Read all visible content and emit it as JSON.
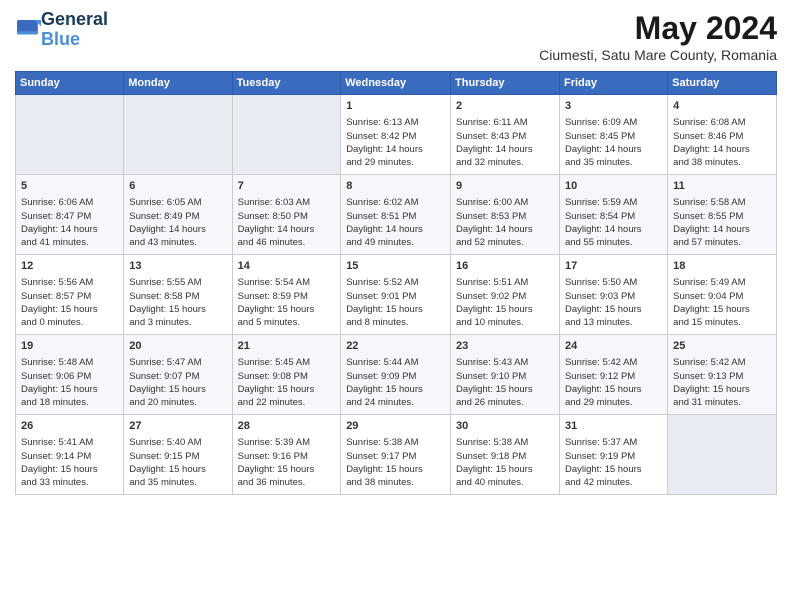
{
  "logo": {
    "line1": "General",
    "line2": "Blue"
  },
  "title": "May 2024",
  "location": "Ciumesti, Satu Mare County, Romania",
  "headers": [
    "Sunday",
    "Monday",
    "Tuesday",
    "Wednesday",
    "Thursday",
    "Friday",
    "Saturday"
  ],
  "weeks": [
    [
      {
        "day": "",
        "content": ""
      },
      {
        "day": "",
        "content": ""
      },
      {
        "day": "",
        "content": ""
      },
      {
        "day": "1",
        "content": "Sunrise: 6:13 AM\nSunset: 8:42 PM\nDaylight: 14 hours\nand 29 minutes."
      },
      {
        "day": "2",
        "content": "Sunrise: 6:11 AM\nSunset: 8:43 PM\nDaylight: 14 hours\nand 32 minutes."
      },
      {
        "day": "3",
        "content": "Sunrise: 6:09 AM\nSunset: 8:45 PM\nDaylight: 14 hours\nand 35 minutes."
      },
      {
        "day": "4",
        "content": "Sunrise: 6:08 AM\nSunset: 8:46 PM\nDaylight: 14 hours\nand 38 minutes."
      }
    ],
    [
      {
        "day": "5",
        "content": "Sunrise: 6:06 AM\nSunset: 8:47 PM\nDaylight: 14 hours\nand 41 minutes."
      },
      {
        "day": "6",
        "content": "Sunrise: 6:05 AM\nSunset: 8:49 PM\nDaylight: 14 hours\nand 43 minutes."
      },
      {
        "day": "7",
        "content": "Sunrise: 6:03 AM\nSunset: 8:50 PM\nDaylight: 14 hours\nand 46 minutes."
      },
      {
        "day": "8",
        "content": "Sunrise: 6:02 AM\nSunset: 8:51 PM\nDaylight: 14 hours\nand 49 minutes."
      },
      {
        "day": "9",
        "content": "Sunrise: 6:00 AM\nSunset: 8:53 PM\nDaylight: 14 hours\nand 52 minutes."
      },
      {
        "day": "10",
        "content": "Sunrise: 5:59 AM\nSunset: 8:54 PM\nDaylight: 14 hours\nand 55 minutes."
      },
      {
        "day": "11",
        "content": "Sunrise: 5:58 AM\nSunset: 8:55 PM\nDaylight: 14 hours\nand 57 minutes."
      }
    ],
    [
      {
        "day": "12",
        "content": "Sunrise: 5:56 AM\nSunset: 8:57 PM\nDaylight: 15 hours\nand 0 minutes."
      },
      {
        "day": "13",
        "content": "Sunrise: 5:55 AM\nSunset: 8:58 PM\nDaylight: 15 hours\nand 3 minutes."
      },
      {
        "day": "14",
        "content": "Sunrise: 5:54 AM\nSunset: 8:59 PM\nDaylight: 15 hours\nand 5 minutes."
      },
      {
        "day": "15",
        "content": "Sunrise: 5:52 AM\nSunset: 9:01 PM\nDaylight: 15 hours\nand 8 minutes."
      },
      {
        "day": "16",
        "content": "Sunrise: 5:51 AM\nSunset: 9:02 PM\nDaylight: 15 hours\nand 10 minutes."
      },
      {
        "day": "17",
        "content": "Sunrise: 5:50 AM\nSunset: 9:03 PM\nDaylight: 15 hours\nand 13 minutes."
      },
      {
        "day": "18",
        "content": "Sunrise: 5:49 AM\nSunset: 9:04 PM\nDaylight: 15 hours\nand 15 minutes."
      }
    ],
    [
      {
        "day": "19",
        "content": "Sunrise: 5:48 AM\nSunset: 9:06 PM\nDaylight: 15 hours\nand 18 minutes."
      },
      {
        "day": "20",
        "content": "Sunrise: 5:47 AM\nSunset: 9:07 PM\nDaylight: 15 hours\nand 20 minutes."
      },
      {
        "day": "21",
        "content": "Sunrise: 5:45 AM\nSunset: 9:08 PM\nDaylight: 15 hours\nand 22 minutes."
      },
      {
        "day": "22",
        "content": "Sunrise: 5:44 AM\nSunset: 9:09 PM\nDaylight: 15 hours\nand 24 minutes."
      },
      {
        "day": "23",
        "content": "Sunrise: 5:43 AM\nSunset: 9:10 PM\nDaylight: 15 hours\nand 26 minutes."
      },
      {
        "day": "24",
        "content": "Sunrise: 5:42 AM\nSunset: 9:12 PM\nDaylight: 15 hours\nand 29 minutes."
      },
      {
        "day": "25",
        "content": "Sunrise: 5:42 AM\nSunset: 9:13 PM\nDaylight: 15 hours\nand 31 minutes."
      }
    ],
    [
      {
        "day": "26",
        "content": "Sunrise: 5:41 AM\nSunset: 9:14 PM\nDaylight: 15 hours\nand 33 minutes."
      },
      {
        "day": "27",
        "content": "Sunrise: 5:40 AM\nSunset: 9:15 PM\nDaylight: 15 hours\nand 35 minutes."
      },
      {
        "day": "28",
        "content": "Sunrise: 5:39 AM\nSunset: 9:16 PM\nDaylight: 15 hours\nand 36 minutes."
      },
      {
        "day": "29",
        "content": "Sunrise: 5:38 AM\nSunset: 9:17 PM\nDaylight: 15 hours\nand 38 minutes."
      },
      {
        "day": "30",
        "content": "Sunrise: 5:38 AM\nSunset: 9:18 PM\nDaylight: 15 hours\nand 40 minutes."
      },
      {
        "day": "31",
        "content": "Sunrise: 5:37 AM\nSunset: 9:19 PM\nDaylight: 15 hours\nand 42 minutes."
      },
      {
        "day": "",
        "content": ""
      }
    ]
  ]
}
